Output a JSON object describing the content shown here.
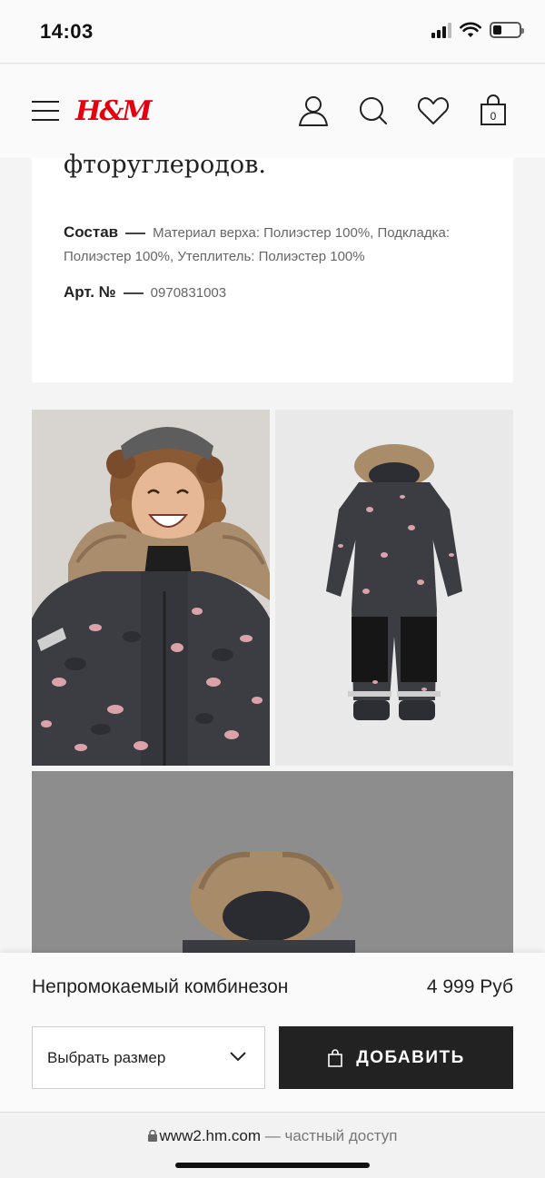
{
  "status_bar": {
    "time": "14:03"
  },
  "header": {
    "logo": "H&M"
  },
  "description": {
    "cut_text": "фторуглеродов.",
    "composition_label": "Состав",
    "composition_value_line1": "Материал верха: Полиэстер 100%, Подкладка:",
    "composition_value_line2": "Полиэстер 100%, Утеплитель: Полиэстер 100%",
    "article_label": "Арт. №",
    "article_value": "0970831003"
  },
  "product": {
    "name": "Непромокаемый комбинезон",
    "price": "4 999 Руб",
    "size_placeholder": "Выбрать размер",
    "add_label": "ДОБАВИТЬ",
    "bag_count": "0"
  },
  "url_bar": {
    "domain": "www2.hm.com",
    "note": "— частный доступ"
  },
  "colors": {
    "brand_red": "#e50010",
    "button_dark": "#222222"
  }
}
